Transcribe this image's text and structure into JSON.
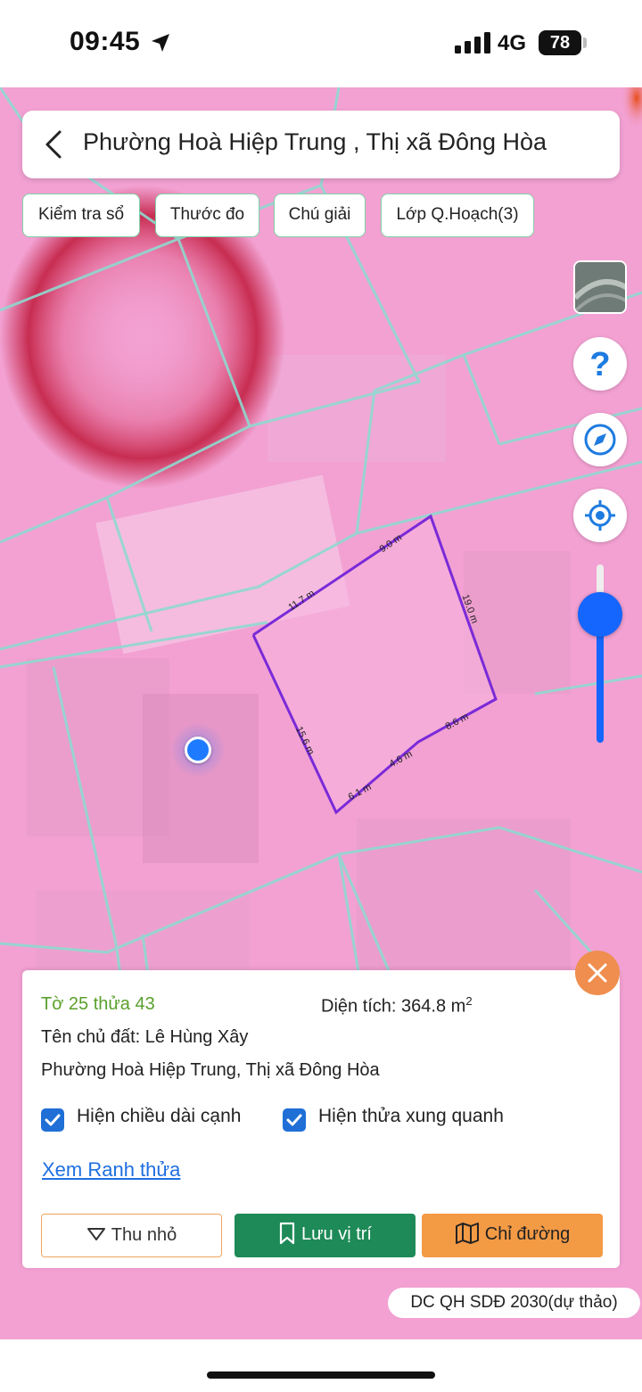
{
  "status_bar": {
    "time": "09:45",
    "network": "4G",
    "battery": "78"
  },
  "header": {
    "title": "Phường Hoà Hiệp Trung , Thị xã Đông Hòa",
    "back_icon": "chevron-left-icon"
  },
  "chips": [
    {
      "label": "Kiểm tra sổ"
    },
    {
      "label": "Thước đo"
    },
    {
      "label": "Chú giải"
    },
    {
      "label": "Lớp Q.Hoạch(3)"
    }
  ],
  "map_controls": {
    "help_label": "?",
    "icons": [
      "satellite-layer-icon",
      "help-icon",
      "compass-icon",
      "my-location-icon"
    ],
    "opacity_slider_level": 0.8
  },
  "parcel_edges": [
    "9.0 m",
    "19.0 m",
    "8.6 m",
    "4.6 m",
    "6.1 m",
    "15.6 m",
    "11.7 m"
  ],
  "panel": {
    "parcel_id": "Tờ 25 thửa 43",
    "area_label": "Diện tích: 364.8 m",
    "area_sup": "2",
    "owner": "Tên chủ đất: Lê Hùng Xây",
    "address": "Phường Hoà Hiệp Trung, Thị xã Đông Hòa",
    "check_edges_label": "Hiện chiều dài cạnh",
    "check_edges_checked": true,
    "check_neighbors_label": "Hiện thửa xung quanh",
    "check_neighbors_checked": true,
    "link_label": "Xem Ranh thửa",
    "btn_shrink": "Thu nhỏ",
    "btn_save": "Lưu vị trí",
    "btn_directions": "Chỉ đường"
  },
  "plan_badge": "DC QH SDĐ 2030(dự thảo)",
  "colors": {
    "map_pink": "#f4a3d4",
    "parcel_stroke": "#7a2ad8",
    "road_line": "#8fd9d0",
    "accent_green": "#1e8a57",
    "accent_orange": "#f39a45",
    "link_blue": "#1e6fe0"
  }
}
